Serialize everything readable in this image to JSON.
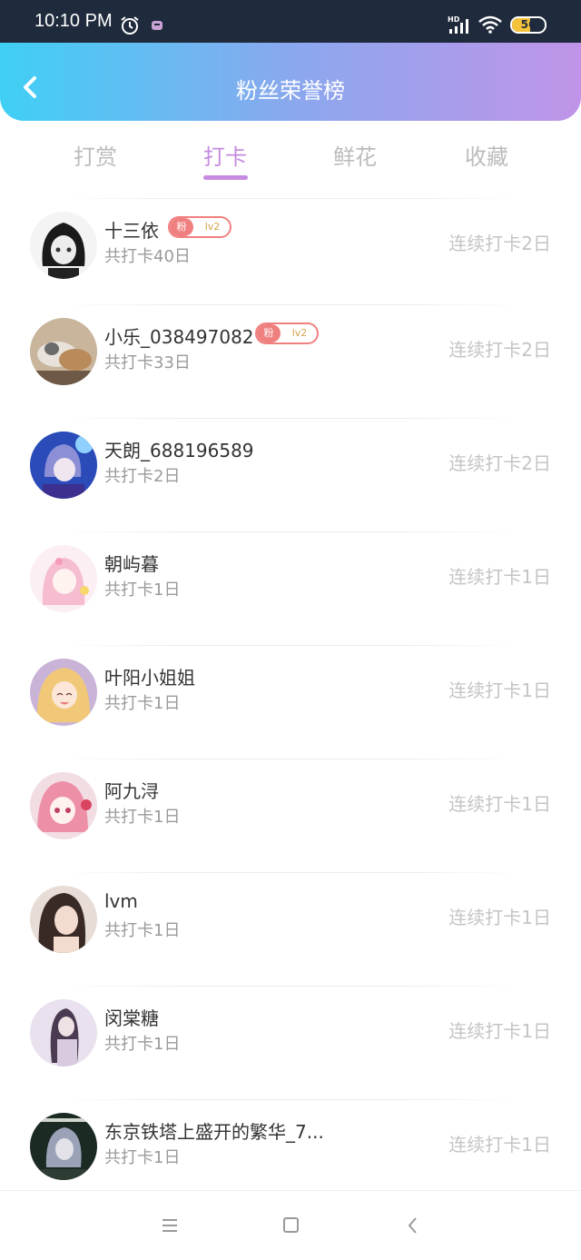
{
  "status_bar": {
    "time": "10:10 PM",
    "battery": "56",
    "battery_level_percent": 56,
    "icons": [
      "alarm-icon",
      "message-icon",
      "hd-signal-icon",
      "wifi-icon",
      "battery-icon"
    ]
  },
  "header": {
    "title": "粉丝荣誉榜",
    "back_icon": "chevron-left-icon",
    "gradient": [
      "#3fd0f5",
      "#8aa8ee",
      "#c094e8"
    ]
  },
  "tabs": [
    {
      "label": "打赏",
      "active": false
    },
    {
      "label": "打卡",
      "active": true
    },
    {
      "label": "鲜花",
      "active": false
    },
    {
      "label": "收藏",
      "active": false
    }
  ],
  "accent_color": "#c68be0",
  "fans": [
    {
      "name": "十三依",
      "badge": {
        "prefix": "粉",
        "level": "lv2"
      },
      "total": "共打卡40日",
      "streak": "连续打卡2日"
    },
    {
      "name": "小乐_038497082",
      "badge": {
        "prefix": "粉",
        "level": "lv2"
      },
      "total": "共打卡33日",
      "streak": "连续打卡2日"
    },
    {
      "name": "天朗_688196589",
      "badge": null,
      "total": "共打卡2日",
      "streak": "连续打卡2日"
    },
    {
      "name": "朝屿暮",
      "badge": null,
      "total": "共打卡1日",
      "streak": "连续打卡1日"
    },
    {
      "name": "叶阳小姐姐",
      "badge": null,
      "total": "共打卡1日",
      "streak": "连续打卡1日"
    },
    {
      "name": "阿九浔",
      "badge": null,
      "total": "共打卡1日",
      "streak": "连续打卡1日"
    },
    {
      "name": "lvm",
      "badge": null,
      "total": "共打卡1日",
      "streak": "连续打卡1日"
    },
    {
      "name": "闵棠糖",
      "badge": null,
      "total": "共打卡1日",
      "streak": "连续打卡1日"
    },
    {
      "name": "东京铁塔上盛开的繁华_7...",
      "badge": null,
      "total": "共打卡1日",
      "streak": "连续打卡1日"
    }
  ],
  "nav_bar": {
    "icons": [
      "menu-icon",
      "home-icon",
      "back-icon"
    ]
  }
}
